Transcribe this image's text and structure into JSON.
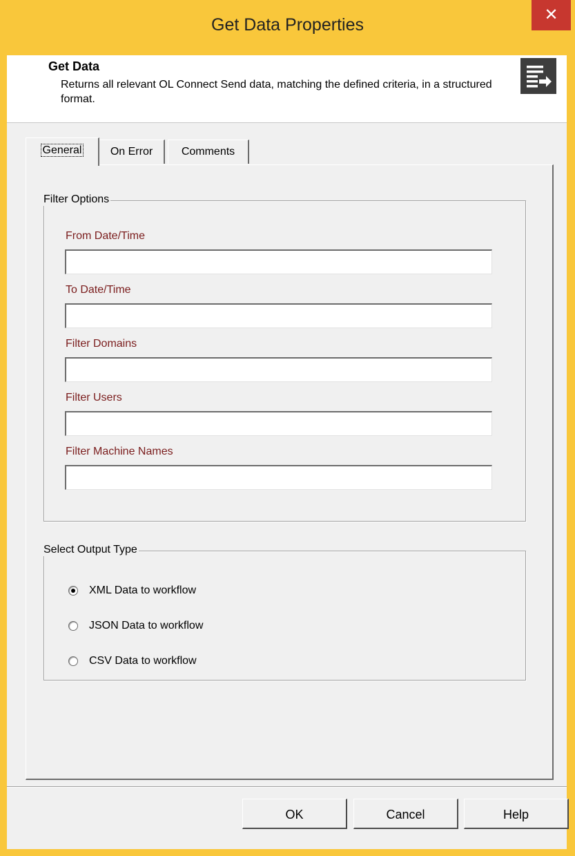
{
  "window": {
    "title": "Get Data Properties",
    "close_glyph": "✕"
  },
  "header": {
    "title": "Get Data",
    "description": "Returns all relevant OL Connect Send data, matching the defined criteria, in a structured format.",
    "icon": "list-arrow-icon"
  },
  "tabs": [
    {
      "label": "General",
      "active": true
    },
    {
      "label": "On Error",
      "active": false
    },
    {
      "label": "Comments",
      "active": false
    }
  ],
  "filter_options": {
    "legend": "Filter Options",
    "fields": [
      {
        "label": "From Date/Time",
        "value": ""
      },
      {
        "label": "To Date/Time",
        "value": ""
      },
      {
        "label": "Filter Domains",
        "value": ""
      },
      {
        "label": "Filter Users",
        "value": ""
      },
      {
        "label": "Filter Machine Names",
        "value": ""
      }
    ]
  },
  "output_type": {
    "legend": "Select Output Type",
    "options": [
      {
        "label": "XML Data to workflow",
        "selected": true
      },
      {
        "label": "JSON Data to workflow",
        "selected": false
      },
      {
        "label": "CSV Data to workflow",
        "selected": false
      }
    ]
  },
  "buttons": {
    "ok": "OK",
    "cancel": "Cancel",
    "help": "Help"
  },
  "colors": {
    "title_bar": "#f9c73b",
    "close_button": "#c7372f",
    "field_label": "#7a1c1c"
  }
}
